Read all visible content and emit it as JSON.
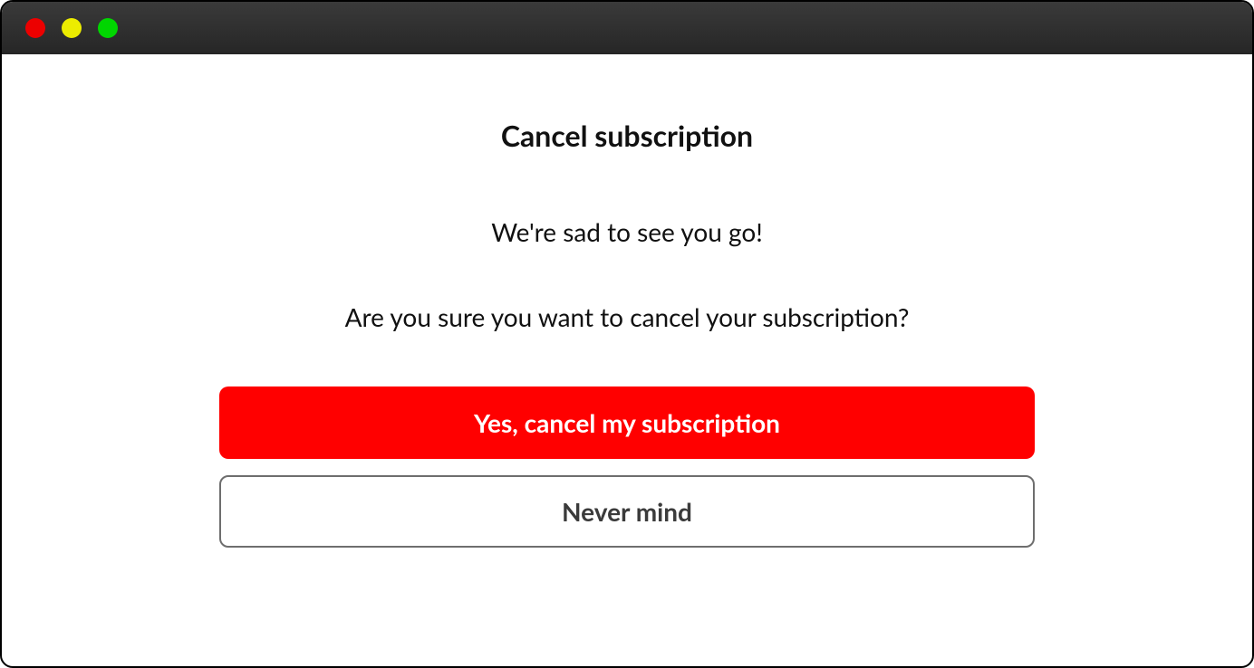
{
  "dialog": {
    "title": "Cancel subscription",
    "message1": "We're sad to see you go!",
    "message2": "Are you sure you want to cancel your subscription?",
    "confirm_label": "Yes, cancel my subscription",
    "cancel_label": "Never mind"
  },
  "colors": {
    "primary_button": "#ff0000",
    "secondary_border": "#6e6e6e"
  }
}
